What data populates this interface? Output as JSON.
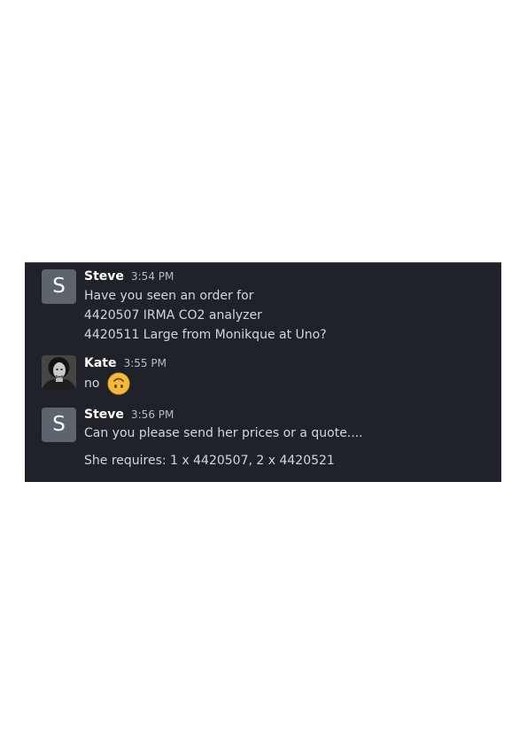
{
  "messages": [
    {
      "author": "Steve",
      "time": "3:54 PM",
      "avatar_letter": "S",
      "lines": [
        "Have you seen an order for",
        "4420507 IRMA CO2 analyzer",
        "4420511 Large from Monikque at Uno?"
      ]
    },
    {
      "author": "Kate",
      "time": "3:55 PM",
      "avatar": "profile-photo",
      "text": "no",
      "emoji": "upside-down-face-emoji"
    },
    {
      "author": "Steve",
      "time": "3:56 PM",
      "avatar_letter": "S",
      "lines": [
        "Can you please send her prices or a quote....",
        "She requires: 1 x 4420507, 2 x 4420521"
      ]
    }
  ],
  "colors": {
    "panel_background": "#1f2229",
    "avatar_letter_background": "#5d646d",
    "author": "#ffffff",
    "message_text": "#d4d6da",
    "timestamp": "#b9bcc1",
    "emoji": "#f5b93a"
  }
}
